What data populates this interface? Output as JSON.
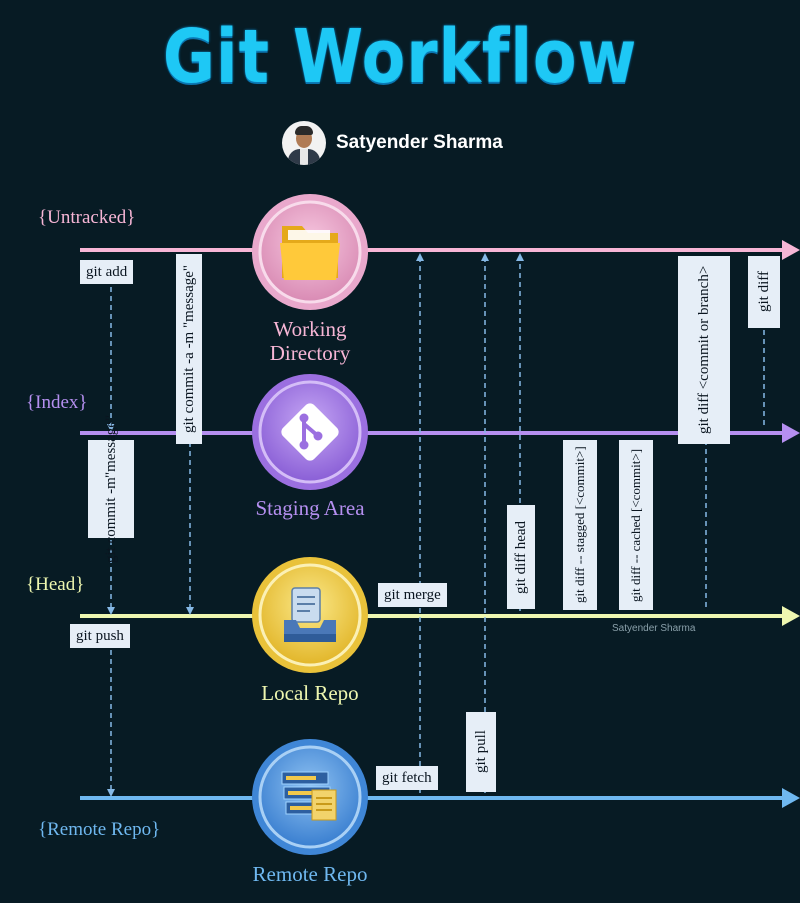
{
  "title": "Git Workflow",
  "author": "Satyender Sharma",
  "watermark": "Satyender Sharma",
  "colors": {
    "background": "#071b24",
    "title": "#1ec8f5",
    "untracked": "#f7b6d6",
    "index": "#b58ff0",
    "head": "#eef7b0",
    "remote": "#6fb8f0",
    "dashed": "#86b9e6",
    "command_box": "#e6eef7"
  },
  "lanes": {
    "untracked": "{Untracked}",
    "index": "{Index}",
    "head": "{Head}",
    "remote": "{Remote Repo}"
  },
  "nodes": {
    "working": {
      "label_line1": "Working",
      "label_line2": "Directory",
      "icon": "folder-icon"
    },
    "staging": {
      "label": "Staging Area",
      "icon": "git-logo-icon"
    },
    "local": {
      "label": "Local Repo",
      "icon": "document-tray-icon"
    },
    "remote": {
      "label": "Remote Repo",
      "icon": "server-rack-icon"
    }
  },
  "commands": {
    "git_add": "git add",
    "commit_am": "git commit -a -m \"message\"",
    "commit_m_line1": "git commit -m",
    "commit_m_line2": "\"message\"",
    "git_push": "git push",
    "git_merge": "git merge",
    "git_fetch": "git fetch",
    "git_pull": "git pull",
    "diff_head": "git diff head",
    "diff_staged": "git diff -- stagged [<commit>]",
    "diff_cached": "git diff -- cached [<commit>]",
    "diff_commit_branch": "git diff <commit or branch>",
    "git_diff": "git diff"
  }
}
